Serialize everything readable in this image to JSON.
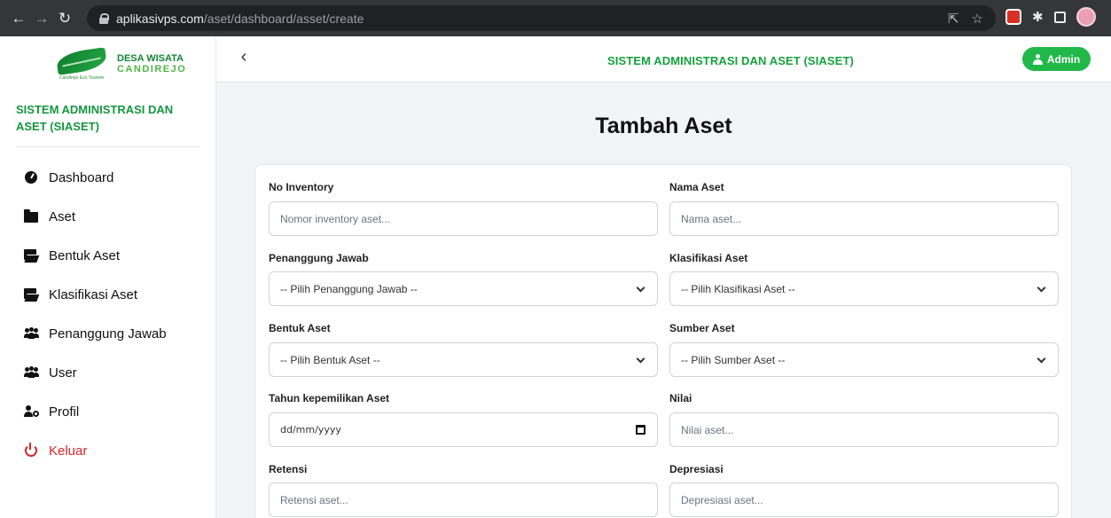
{
  "browser": {
    "url_host": "aplikasivps.com",
    "url_path": "/aset/dashboard/asset/create"
  },
  "sidebar": {
    "logo_line1": "DESA WISATA",
    "logo_line2": "CANDIREJO",
    "logo_caption": "Candirejo Eco Tourism",
    "app_title": "SISTEM ADMINISTRASI DAN ASET (SIASET)",
    "items": [
      {
        "label": "Dashboard",
        "icon": "dashboard-icon"
      },
      {
        "label": "Aset",
        "icon": "folder-icon"
      },
      {
        "label": "Bentuk Aset",
        "icon": "folder-open-icon"
      },
      {
        "label": "Klasifikasi Aset",
        "icon": "folder-open-icon"
      },
      {
        "label": "Penanggung Jawab",
        "icon": "users-icon"
      },
      {
        "label": "User",
        "icon": "users-icon"
      },
      {
        "label": "Profil",
        "icon": "user-gear-icon"
      },
      {
        "label": "Keluar",
        "icon": "power-icon"
      }
    ]
  },
  "topbar": {
    "title": "SISTEM ADMINISTRASI DAN ASET (SIASET)",
    "admin_label": "Admin"
  },
  "page": {
    "title": "Tambah Aset"
  },
  "form": {
    "no_inventory": {
      "label": "No Inventory",
      "placeholder": "Nomor inventory aset..."
    },
    "nama_aset": {
      "label": "Nama Aset",
      "placeholder": "Nama aset..."
    },
    "penanggung_jawab": {
      "label": "Penanggung Jawab",
      "selected": "-- Pilih Penanggung Jawab --"
    },
    "klasifikasi_aset": {
      "label": "Klasifikasi Aset",
      "selected": "-- Pilih Klasifikasi Aset --"
    },
    "bentuk_aset": {
      "label": "Bentuk Aset",
      "selected": "-- Pilih Bentuk Aset --"
    },
    "sumber_aset": {
      "label": "Sumber Aset",
      "selected": "-- Pilih Sumber Aset --"
    },
    "tahun": {
      "label": "Tahun kepemilikan Aset",
      "value": "dd/mm/yyyy"
    },
    "nilai": {
      "label": "Nilai",
      "placeholder": "Nilai aset..."
    },
    "retensi": {
      "label": "Retensi",
      "placeholder": "Retensi aset..."
    },
    "depresiasi": {
      "label": "Depresiasi",
      "placeholder": "Depresiasi aset..."
    }
  },
  "colors": {
    "brand_green": "#14a23d",
    "danger": "#d9262b"
  }
}
